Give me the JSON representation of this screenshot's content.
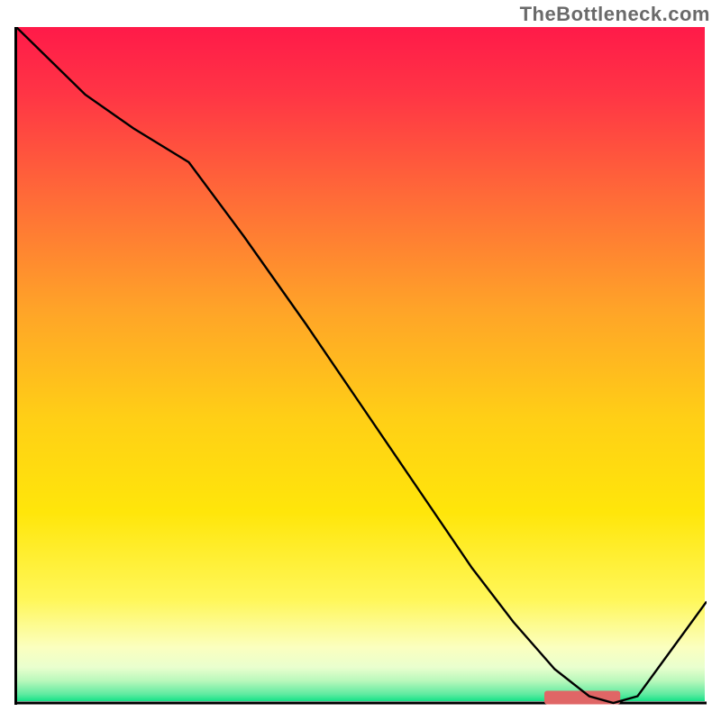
{
  "watermark": "TheBottleneck.com",
  "chart_data": {
    "type": "line",
    "title": "",
    "xlabel": "",
    "ylabel": "",
    "xlim": [
      0,
      100
    ],
    "ylim": [
      0,
      100
    ],
    "grid": false,
    "legend": false,
    "background_gradient": {
      "top": "#ff1a49",
      "mid": "#ffe400",
      "green_band_top": "#f9ffc8",
      "green_band_bottom": "#14e287"
    },
    "series": [
      {
        "name": "bottleneck-curve",
        "color": "#000000",
        "x": [
          0,
          5,
          10,
          17,
          25,
          33,
          42,
          50,
          58,
          66,
          72,
          78,
          83,
          86.5,
          90,
          95,
          100
        ],
        "y": [
          100,
          95,
          90,
          85,
          80,
          69,
          56,
          44,
          32,
          20,
          12,
          5,
          1,
          0,
          1,
          8,
          15
        ]
      }
    ],
    "axes": {
      "show_x_axis": true,
      "show_y_axis": true,
      "axis_color": "#000000",
      "axis_width": 2
    },
    "marker": {
      "x": 82,
      "width": 11,
      "height": 1.2,
      "color": "#e06666"
    }
  }
}
